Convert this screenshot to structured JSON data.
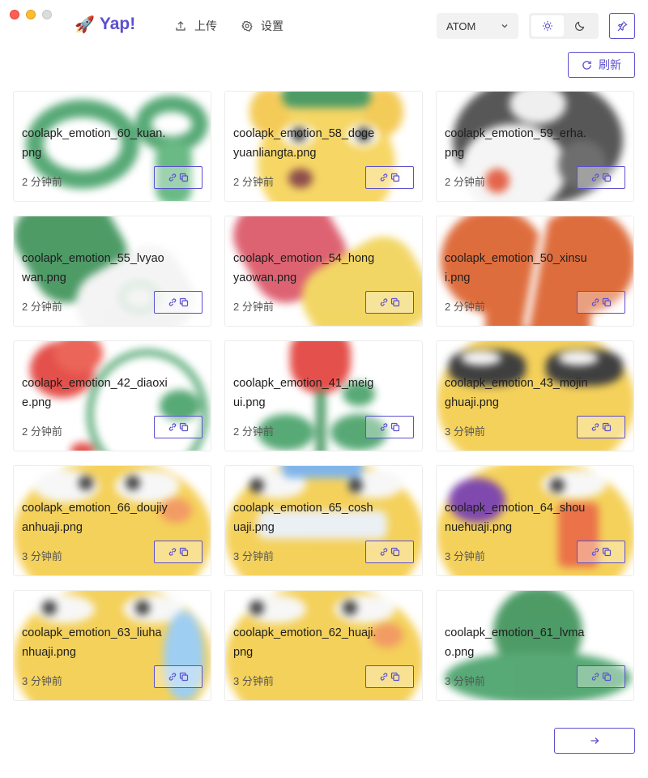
{
  "app": {
    "name": "Yap!",
    "logo_icon": "rocket-icon"
  },
  "nav": {
    "upload_label": "上传",
    "settings_label": "设置"
  },
  "toolbar": {
    "editor_select_value": "ATOM",
    "theme_options": [
      "light",
      "dark"
    ],
    "theme_selected": "light",
    "refresh_label": "刷新"
  },
  "colors": {
    "accent": "#5b4fcf"
  },
  "images": [
    {
      "filename": "coolapk_emotion_60_kuan.png",
      "time": "2 分钟前"
    },
    {
      "filename": "coolapk_emotion_58_dogeyuanliangta.png",
      "time": "2 分钟前"
    },
    {
      "filename": "coolapk_emotion_59_erha.png",
      "time": "2 分钟前"
    },
    {
      "filename": "coolapk_emotion_55_lvyaowan.png",
      "time": "2 分钟前"
    },
    {
      "filename": "coolapk_emotion_54_hongyaowan.png",
      "time": "2 分钟前"
    },
    {
      "filename": "coolapk_emotion_50_xinsui.png",
      "time": "2 分钟前"
    },
    {
      "filename": "coolapk_emotion_42_diaoxie.png",
      "time": "2 分钟前"
    },
    {
      "filename": "coolapk_emotion_41_meigui.png",
      "time": "2 分钟前"
    },
    {
      "filename": "coolapk_emotion_43_mojinghuaji.png",
      "time": "3 分钟前"
    },
    {
      "filename": "coolapk_emotion_66_doujiyanhuaji.png",
      "time": "3 分钟前"
    },
    {
      "filename": "coolapk_emotion_65_coshuaji.png",
      "time": "3 分钟前"
    },
    {
      "filename": "coolapk_emotion_64_shounuehuaji.png",
      "time": "3 分钟前"
    },
    {
      "filename": "coolapk_emotion_63_liuhanhuaji.png",
      "time": "3 分钟前"
    },
    {
      "filename": "coolapk_emotion_62_huaji.png",
      "time": "3 分钟前"
    },
    {
      "filename": "coolapk_emotion_61_lvmao.png",
      "time": "3 分钟前"
    }
  ]
}
